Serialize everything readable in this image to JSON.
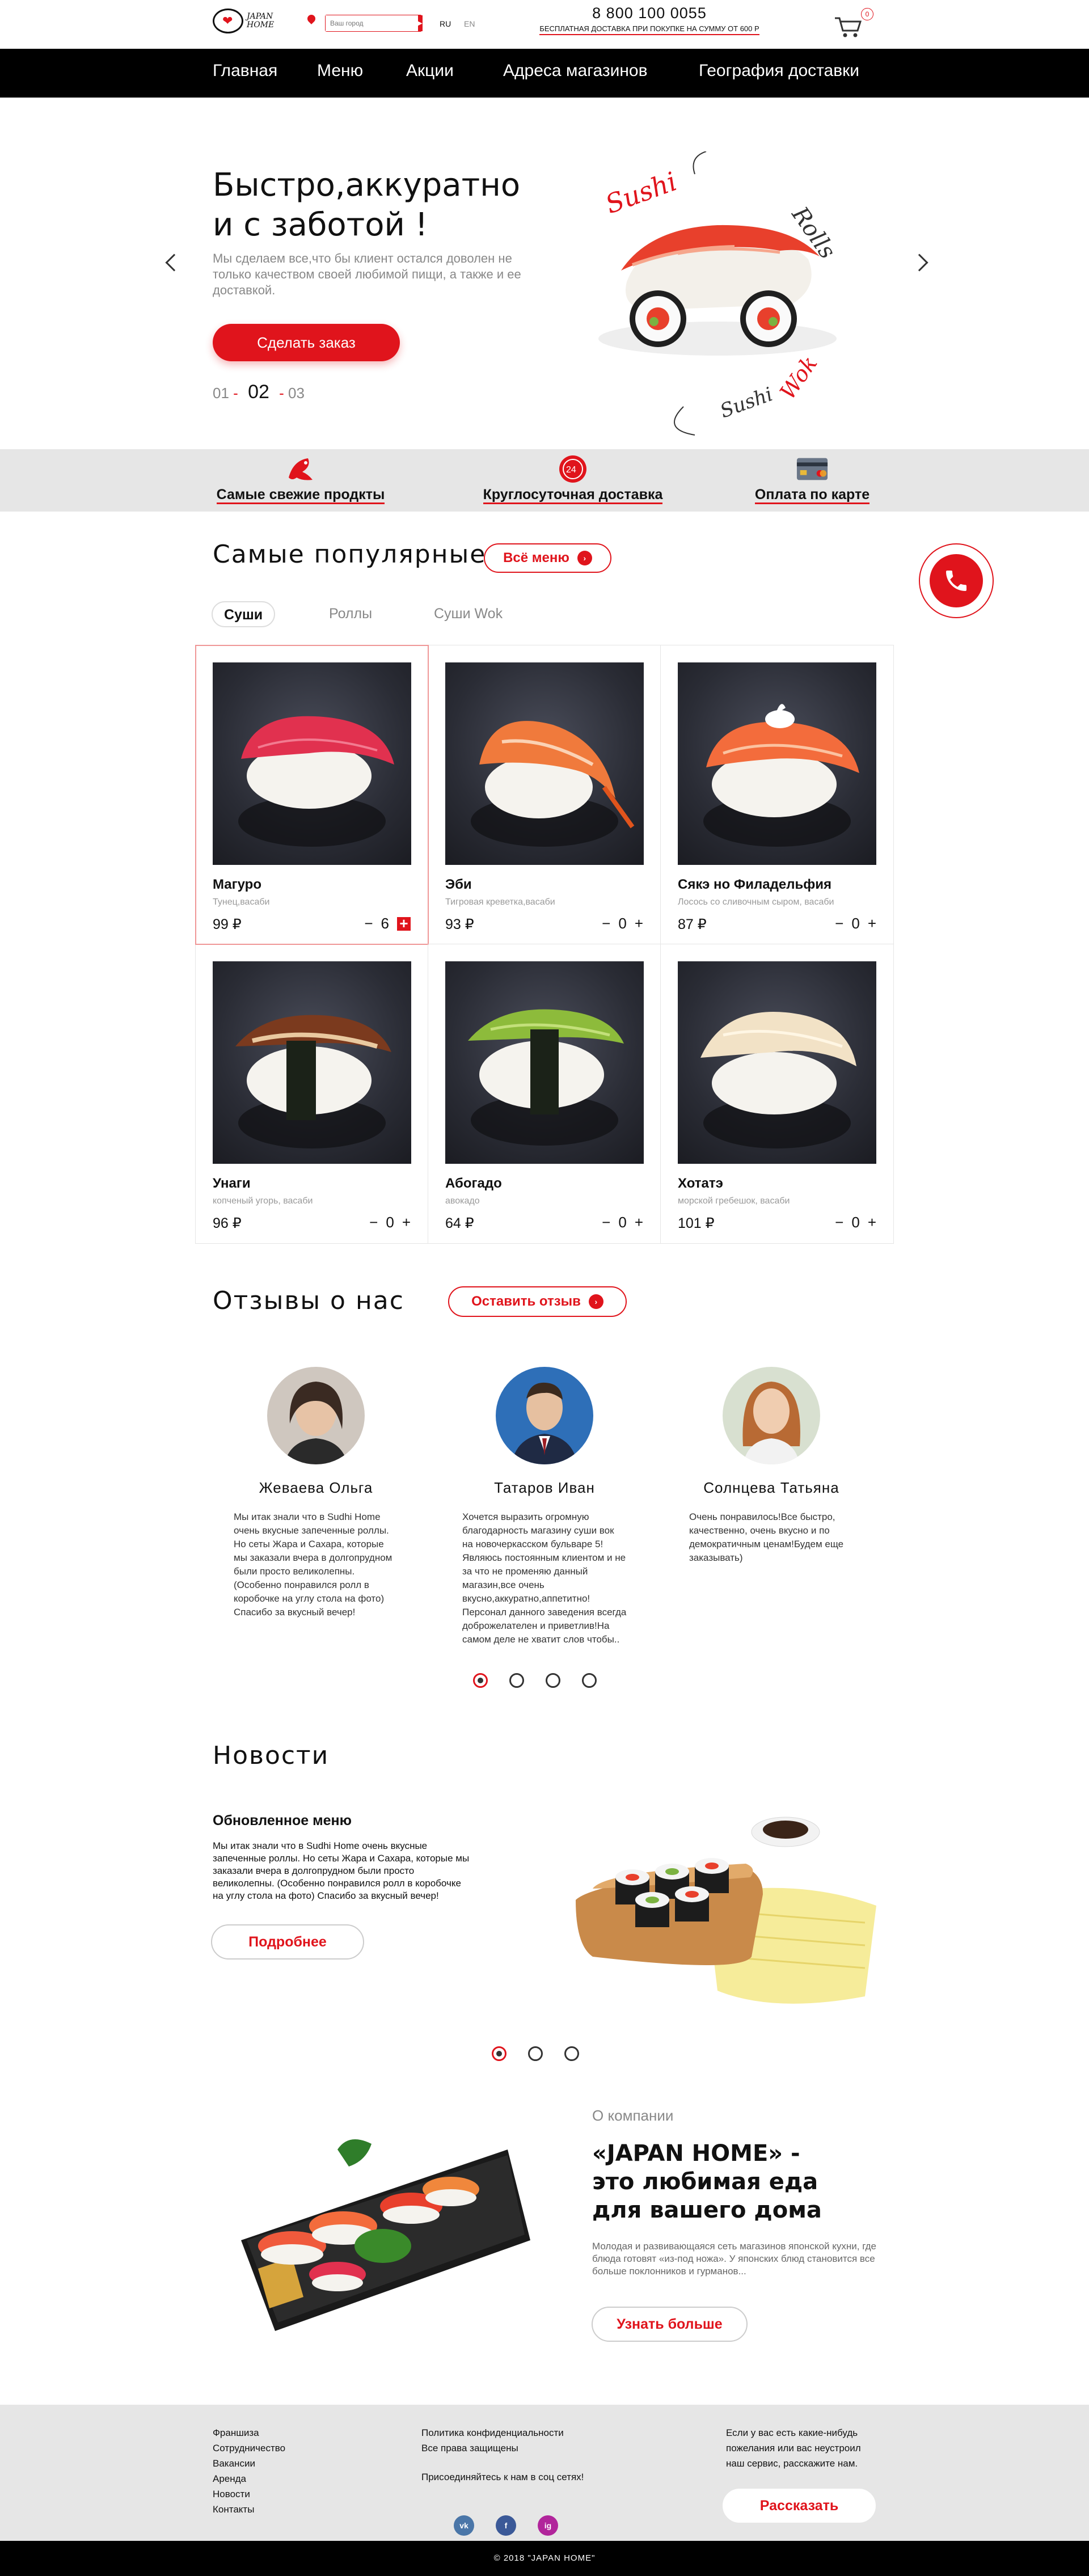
{
  "header": {
    "logo_text_1": "JAPAN",
    "logo_text_2": "HOME",
    "city_placeholder": "Ваш город",
    "lang_ru": "RU",
    "lang_en": "EN",
    "phone": "8 800 100 0055",
    "delivery_note": "БЕСПЛАТНАЯ ДОСТАВКА ПРИ ПОКУПКЕ НА СУММУ ОТ 600 Р",
    "cart_count": "0"
  },
  "nav": {
    "items": [
      "Главная",
      "Меню",
      "Акции",
      "Адреса магазинов",
      "География доставки"
    ]
  },
  "hero": {
    "title_line1": "Быстро,аккуратно",
    "title_line2": "и с заботой !",
    "text": "Мы сделаем все,что бы клиент остался доволен не только качеством своей любимой пищи, а также и ее доставкой.",
    "button": "Сделать заказ",
    "pager_prev": "01",
    "pager_current": "02",
    "pager_next": "03",
    "art_labels": [
      "Sushi",
      "Rolls",
      "Sushi",
      "Wok"
    ]
  },
  "features": [
    {
      "label": "Самые свежие продкты"
    },
    {
      "label": "Круглосуточная доставка"
    },
    {
      "label": "Оплата по карте"
    }
  ],
  "popular": {
    "title": "Самые популярные",
    "all_menu": "Всё меню",
    "tabs": [
      "Суши",
      "Роллы",
      "Суши Wok"
    ],
    "products": [
      {
        "name": "Магуро",
        "desc": "Тунец,васаби",
        "price": "99 ₽",
        "qty": "6"
      },
      {
        "name": "Эби",
        "desc": "Тигровая креветка,васаби",
        "price": "93 ₽",
        "qty": "0"
      },
      {
        "name": "Сякэ но Филадельфия",
        "desc": "Лосось со сливочным сыром, васаби",
        "price": "87 ₽",
        "qty": "0"
      },
      {
        "name": "Унаги",
        "desc": "копченый угорь, васаби",
        "price": "96 ₽",
        "qty": "0"
      },
      {
        "name": "Абогадо",
        "desc": "авокадо",
        "price": "64 ₽",
        "qty": "0"
      },
      {
        "name": "Хотатэ",
        "desc": "морской гребешок, васаби",
        "price": "101 ₽",
        "qty": "0"
      }
    ]
  },
  "reviews": {
    "title": "Отзывы о нас",
    "leave_button": "Оставить отзыв",
    "items": [
      {
        "name": "Жеваева Ольга",
        "text": "Мы итак знали что в Sudhi Home очень вкусные запеченные роллы. Но сеты Жара и Сахара, которые мы заказали вчера в долгопрудном были просто великолепны. (Особенно понравился ролл в коробочке на углу стола на фото) Спасибо за вкусный вечер!"
      },
      {
        "name": "Татаров Иван",
        "text": "Хочется выразить огромную благодарность магазину суши вок на новочеркасском бульваре 5!Являюсь постоянным клиентом и не за что не променяю данный магазин,все очень вкусно,аккуратно,аппетитно! Персонал данного заведения всегда доброжелателен и приветлив!На самом деле не хватит слов чтобы.."
      },
      {
        "name": "Солнцева Татьяна",
        "text": "Очень понравилось!Все быстро, качественно, очень вкусно и по демократичным ценам!Будем еще заказывать)"
      }
    ]
  },
  "news": {
    "title": "Новости",
    "item_title": "Обновленное меню",
    "item_text": "Мы итак знали что в Sudhi Home очень вкусные запеченные роллы. Но сеты Жара и Сахара, которые мы заказали вчера в долгопрудном были просто великолепны. (Особенно понравился ролл в коробочке на углу стола на фото) Спасибо за вкусный вечер!",
    "more_button": "Подробнее"
  },
  "about": {
    "kicker": "О компании",
    "title_line1": "«JAPAN HOME» -",
    "title_line2": "это любимая еда",
    "title_line3": "для вашего дома",
    "text": "Молодая и развивающаяся сеть магазинов японской кухни, где блюда готовят «из-под ножа». У японских блюд становится все больше поклонников и гурманов...",
    "button": "Узнать больше"
  },
  "footer": {
    "col1": [
      "Франшиза",
      "Сотрудничество",
      "Вакансии",
      "Аренда",
      "Новости",
      "Контакты"
    ],
    "col2": [
      "Политика конфиденциальности",
      "Все права защищены"
    ],
    "social_label": "Присоединяйтесь к нам в соц сетях!",
    "social": [
      "vk",
      "f",
      "ig"
    ],
    "col3_text": "Если у вас есть какие-нибудь пожелания или вас неустроил наш сервис, расскажите нам.",
    "tell_button": "Рассказать",
    "copyright": "© 2018 \"JAPAN HOME\""
  },
  "colors": {
    "accent": "#e0141c",
    "nav_bg": "#000000",
    "band_bg": "#e6e6e6"
  }
}
